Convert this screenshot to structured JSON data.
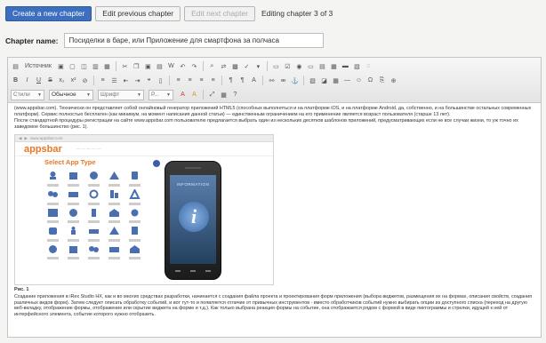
{
  "toolbar_top": {
    "create_label": "Create a new chapter",
    "edit_prev_label": "Edit previous chapter",
    "edit_next_label": "Edit next chapter",
    "status_text": "Editing chapter 3 of 3"
  },
  "chapter": {
    "label": "Chapter name:",
    "value": "Посиделки в баре, или Приложение для смартфона за полчаса"
  },
  "editor": {
    "source_label": "Источник",
    "style_select": "Стили",
    "format_select": "Обычное",
    "font_select": "Шрифт",
    "size_select": "Р...",
    "paragraph1": "(www.appsbar.com). Технически он представляет собой онлайновый генератор приложений HTML5 (способных выполняться и на платформе iOS, и на платформе Android, да, собственно, и на большинстве остальных современных платформ). Сервис полностью бесплатен (как минимум, на момент написания данной статьи) — единственным ограничением на его применение является возраст пользователя (старше 13 лет).",
    "paragraph2": "После стандартной процедуры регистрации на сайте www.appsbar.com пользователю предлагается выбрать один из нескольких десятков шаблонов приложений, предусматривающих если не все случаи жизни, то уж точно их заведомое большинство (рис. 1).",
    "figure": {
      "url": "www.appsbar.com",
      "logo_main": "appsbar",
      "select_title": "Select App Type",
      "screen_label": "INFORMATION"
    },
    "figure_label": "Рис. 1",
    "paragraph3": "Создание приложения в iRex Studio HX, как и во многих средствах разработки, начинается с создания файла проекта и проектирования форм приложения (выбора виджетов, размещения их на формах, описания свойств, создания различных видов форм). Затем следует описать обработку событий, и вот тут-то и появляется отличие от привычных инструментов - вместо обработчиков событий нужно выбирать опции из доступного списка (переход на другую веб-вкладку, отображение формы, отображение или скрытие виджета на форме и т.д.). Как только выбрана реакция формы на событие, она отображается рядом с формой в виде пиктограммы и стрелки, идущей к ней от интерфейсного элемента, событие которого нужно отобразить."
  },
  "colors": {
    "primary_button": "#3d6fbe",
    "brand_orange": "#e87722",
    "help_dot": "#3d5ca8"
  }
}
